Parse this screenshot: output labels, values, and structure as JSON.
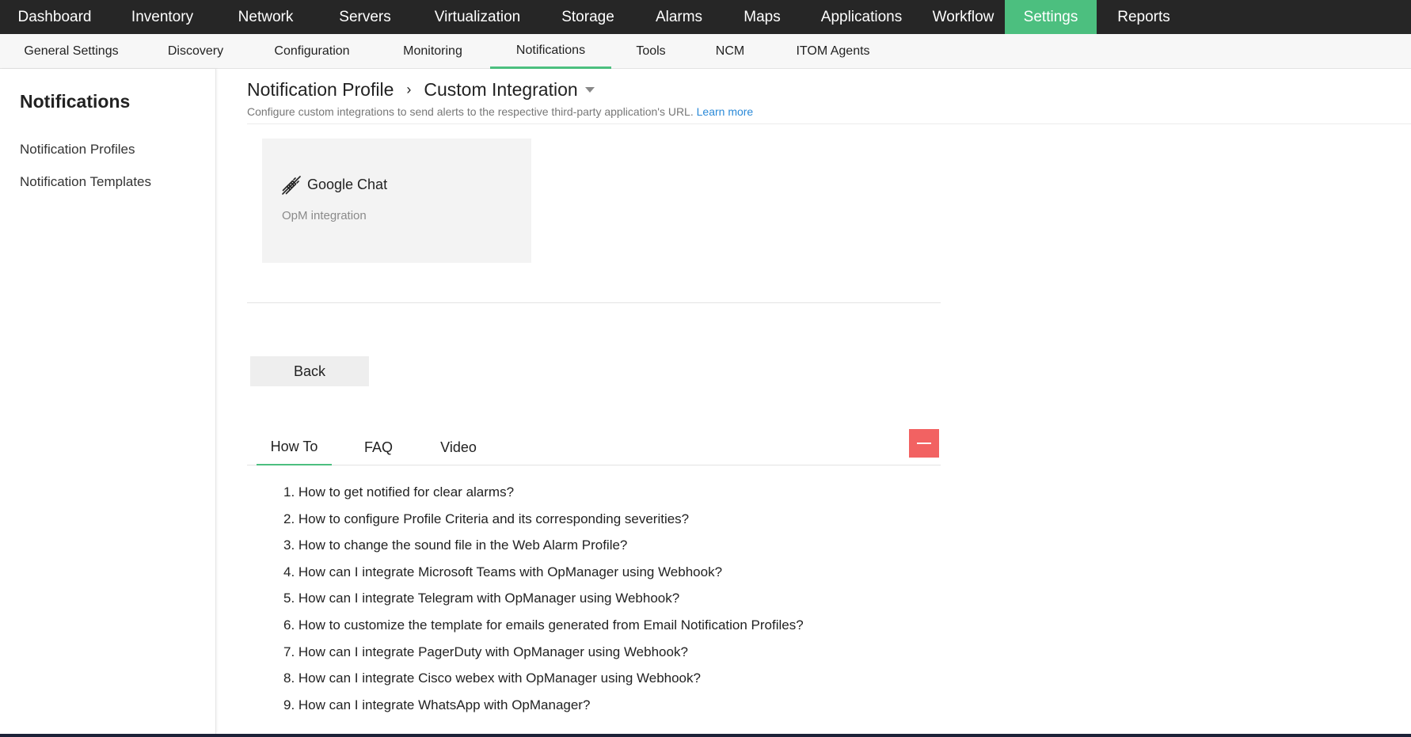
{
  "topnav": {
    "items": [
      {
        "label": "Dashboard"
      },
      {
        "label": "Inventory"
      },
      {
        "label": "Network"
      },
      {
        "label": "Servers"
      },
      {
        "label": "Virtualization"
      },
      {
        "label": "Storage"
      },
      {
        "label": "Alarms"
      },
      {
        "label": "Maps"
      },
      {
        "label": "Applications"
      },
      {
        "label": "Workflow"
      },
      {
        "label": "Settings",
        "active": true
      },
      {
        "label": "Reports"
      }
    ],
    "active_color": "#4cbf7f",
    "background": "#262626"
  },
  "subnav": {
    "items": [
      {
        "label": "General Settings"
      },
      {
        "label": "Discovery"
      },
      {
        "label": "Configuration"
      },
      {
        "label": "Monitoring"
      },
      {
        "label": "Notifications",
        "active": true
      },
      {
        "label": "Tools"
      },
      {
        "label": "NCM"
      },
      {
        "label": "ITOM Agents"
      }
    ]
  },
  "sidebar": {
    "title": "Notifications",
    "links": [
      {
        "label": "Notification Profiles"
      },
      {
        "label": "Notification Templates"
      }
    ]
  },
  "main": {
    "breadcrumb": {
      "parent": "Notification Profile",
      "current": "Custom Integration",
      "separator": "›"
    },
    "subtitle": "Configure custom integrations to send alerts to the respective third-party application's URL.",
    "learn_more": "Learn more",
    "integration_card": {
      "icon": "plug-connect-icon",
      "name": "Google Chat",
      "description": "OpM integration"
    },
    "back_label": "Back",
    "help": {
      "tabs": [
        {
          "label": "How To",
          "active": true
        },
        {
          "label": "FAQ"
        },
        {
          "label": "Video"
        }
      ],
      "collapse_icon": "minus-icon",
      "collapse_color": "#f26262",
      "howto_items": [
        "1. How to get notified for clear alarms?",
        "2. How to configure Profile Criteria and its corresponding severities?",
        "3. How to change the sound file in the Web Alarm Profile?",
        "4. How can I integrate Microsoft Teams with OpManager using Webhook?",
        "5. How can I integrate Telegram with OpManager using Webhook?",
        "6. How to customize the template for emails generated from Email Notification Profiles?",
        "7. How can I integrate PagerDuty with OpManager using Webhook?",
        "8. How can I integrate Cisco webex with OpManager using Webhook?",
        "9. How can I integrate WhatsApp with OpManager?"
      ]
    }
  }
}
